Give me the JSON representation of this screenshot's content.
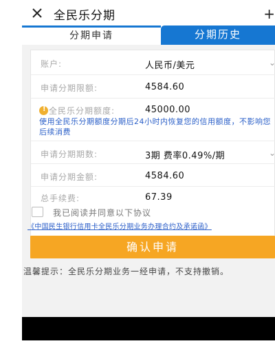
{
  "header": {
    "title": "全民乐分期",
    "more_glyph": "+"
  },
  "tabs": [
    {
      "label": "分期申请",
      "active": true
    },
    {
      "label": "分期历史",
      "active": false
    }
  ],
  "form": {
    "account": {
      "label": "账户:",
      "value": "人民币/美元"
    },
    "limit": {
      "label": "申请分期限额:",
      "value": "4584.60"
    },
    "quota": {
      "label": "全民乐分期额度:",
      "value": "45000.00"
    },
    "note": "使用全民乐分期额度分期后24小时内恢复您的信用额度，不影响您后续消费",
    "periods": {
      "label": "申请分期期数:",
      "value": "3期 费率0.49%/期"
    },
    "amount": {
      "label": "申请分期金额:",
      "value": "4584.60"
    },
    "fee": {
      "label": "总手续费:",
      "value": "67.39"
    }
  },
  "agreement": {
    "checkbox_text": "我已阅读并同意以下协议",
    "checked": false,
    "link_text": "《中国民生银行信用卡全民乐分期业务办理合约及承诺函》"
  },
  "confirm_button": "确认申请",
  "tip": "温馨提示：全民乐分期业务一经申请，不支持撤销。",
  "colors": {
    "accent_blue": "#1677d2",
    "confirm_orange": "#f6a623",
    "note_blue": "#2a5fc8",
    "info_yellow": "#f0b030"
  }
}
